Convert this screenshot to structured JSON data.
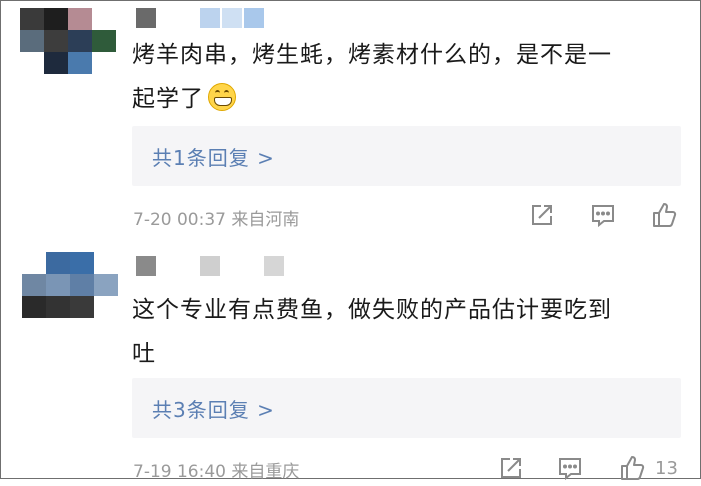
{
  "comments": [
    {
      "text_line1": "烤羊肉串，烤生蚝，烤素材什么的，是不是一",
      "text_line2": "起学了",
      "emoji": "grinning-face-emoji",
      "replies_label": "共1条回复 >",
      "timestamp": "7-20 00:37",
      "location": "来自河南",
      "like_count": ""
    },
    {
      "text_line1": "这个专业有点费鱼，做失败的产品估计要吃到",
      "text_line2": "吐",
      "replies_label": "共3条回复 >",
      "timestamp": "7-19 16:40",
      "location": "来自重庆",
      "like_count": "13"
    }
  ],
  "icons": {
    "share": "share-icon",
    "comment": "comment-icon",
    "like": "thumbs-up-icon"
  },
  "colors": {
    "text": "#1a1a1a",
    "link": "#5b7fb3",
    "meta": "#9a9a9a",
    "reply_bg": "#f5f5f7"
  }
}
